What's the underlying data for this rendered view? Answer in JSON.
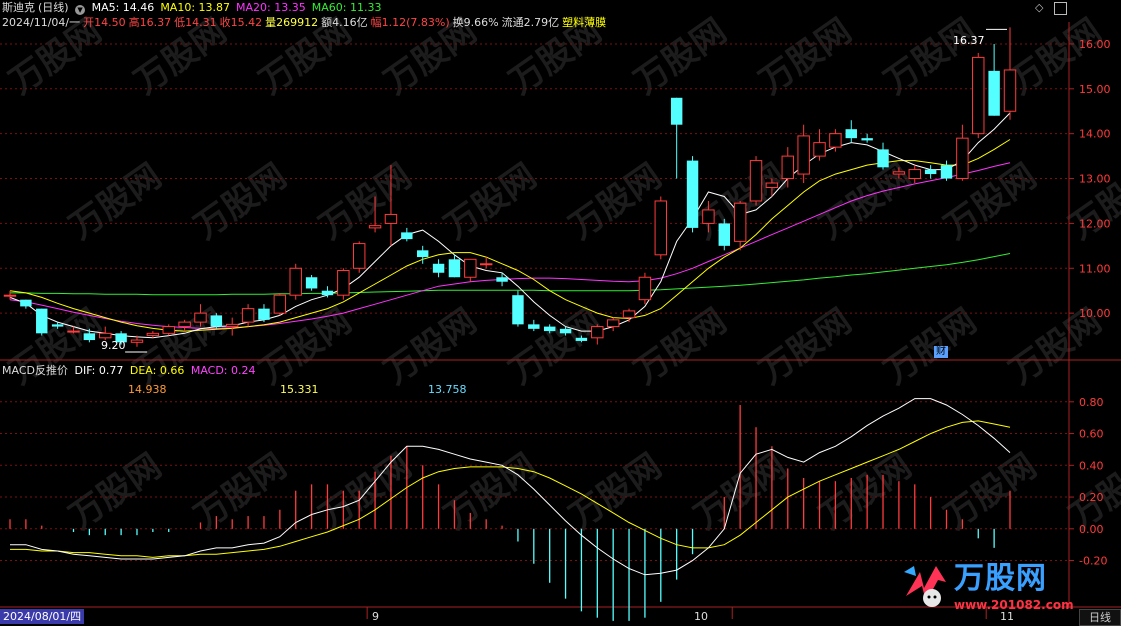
{
  "header": {
    "stock_name": "斯迪克",
    "period_label": "(日线)",
    "ma_items": [
      {
        "label": "MA5: 14.46",
        "color": "#ffffff"
      },
      {
        "label": "MA10: 13.87",
        "color": "#ffff00"
      },
      {
        "label": "MA20: 13.35",
        "color": "#ff33ff"
      },
      {
        "label": "MA60: 11.33",
        "color": "#33ee33"
      }
    ],
    "ohlc": [
      {
        "text": "2024/11/04/一",
        "color": "#dddddd"
      },
      {
        "text": "开14.50",
        "color": "#ff4444"
      },
      {
        "text": "高16.37",
        "color": "#ff4444"
      },
      {
        "text": "低14.31",
        "color": "#ff4444"
      },
      {
        "text": "收15.42",
        "color": "#ff4444"
      },
      {
        "text": "量269912",
        "color": "#ffff44"
      },
      {
        "text": "额4.16亿",
        "color": "#dddddd"
      },
      {
        "text": "幅1.12(7.83%)",
        "color": "#ff4444"
      },
      {
        "text": "换9.66%",
        "color": "#dddddd"
      },
      {
        "text": "流通2.79亿",
        "color": "#dddddd"
      },
      {
        "text": "塑料薄膜",
        "color": "#ffff00"
      }
    ]
  },
  "annotations": {
    "high_label": "16.37",
    "low_label": "9.20",
    "cai_badge": "财"
  },
  "macd_header": {
    "title": "MACD反推价",
    "dif": "DIF: 0.77",
    "dea": "DEA: 0.66",
    "macd": "MACD: 0.24",
    "values": [
      {
        "text": "14.938",
        "color": "#ff9933"
      },
      {
        "text": "15.331",
        "color": "#ffff55"
      },
      {
        "text": "13.758",
        "color": "#66ddff"
      }
    ]
  },
  "footer": {
    "date_label": "2024/08/01/四",
    "month_labels": [
      "9",
      "10",
      "11"
    ],
    "period_button": "日线"
  },
  "watermark": {
    "brand": "万股网",
    "url": "www.201082.com"
  },
  "colors": {
    "up": "#ff3b3b",
    "down": "#54ffff",
    "ma5": "#ffffff",
    "ma10": "#ffff00",
    "ma20": "#ff33ff",
    "ma60": "#33ee33",
    "grid": "#7a1010",
    "axis": "#aa2222"
  },
  "chart_data": [
    {
      "type": "candlestick",
      "ylim": [
        9.0,
        16.4
      ],
      "yticks": [
        "16.00",
        "15.00",
        "14.00",
        "13.00",
        "12.00",
        "11.00",
        "10.00"
      ],
      "ytick_values": [
        16,
        15,
        14,
        13,
        12,
        11,
        10
      ],
      "candles": [
        [
          10.4,
          10.5,
          10.3,
          10.4
        ],
        [
          10.3,
          10.3,
          10.1,
          10.15
        ],
        [
          10.1,
          10.1,
          9.5,
          9.55
        ],
        [
          9.75,
          9.8,
          9.65,
          9.7
        ],
        [
          9.6,
          9.7,
          9.55,
          9.6
        ],
        [
          9.55,
          9.65,
          9.35,
          9.4
        ],
        [
          9.45,
          9.7,
          9.4,
          9.55
        ],
        [
          9.55,
          9.6,
          9.3,
          9.35
        ],
        [
          9.35,
          9.5,
          9.25,
          9.4
        ],
        [
          9.5,
          9.6,
          9.45,
          9.55
        ],
        [
          9.55,
          9.75,
          9.5,
          9.7
        ],
        [
          9.7,
          9.85,
          9.6,
          9.8
        ],
        [
          9.8,
          10.2,
          9.7,
          10.0
        ],
        [
          9.95,
          10.0,
          9.65,
          9.7
        ],
        [
          9.7,
          9.9,
          9.5,
          9.75
        ],
        [
          9.8,
          10.2,
          9.7,
          10.1
        ],
        [
          10.1,
          10.2,
          9.8,
          9.85
        ],
        [
          10.0,
          10.45,
          9.95,
          10.4
        ],
        [
          10.4,
          11.1,
          10.3,
          11.0
        ],
        [
          10.8,
          10.85,
          10.5,
          10.55
        ],
        [
          10.5,
          10.6,
          10.35,
          10.4
        ],
        [
          10.4,
          11.0,
          10.3,
          10.95
        ],
        [
          11.0,
          11.6,
          10.9,
          11.55
        ],
        [
          11.9,
          12.6,
          11.8,
          11.95
        ],
        [
          12.0,
          13.3,
          11.5,
          12.2
        ],
        [
          11.8,
          11.9,
          11.6,
          11.65
        ],
        [
          11.4,
          11.5,
          11.1,
          11.25
        ],
        [
          11.1,
          11.2,
          10.8,
          10.9
        ],
        [
          11.2,
          11.3,
          10.8,
          10.8
        ],
        [
          10.8,
          11.2,
          10.7,
          11.2
        ],
        [
          11.1,
          11.25,
          11.0,
          11.1
        ],
        [
          10.8,
          10.9,
          10.6,
          10.7
        ],
        [
          10.4,
          10.5,
          9.7,
          9.75
        ],
        [
          9.75,
          9.85,
          9.6,
          9.65
        ],
        [
          9.7,
          9.75,
          9.55,
          9.6
        ],
        [
          9.65,
          9.7,
          9.5,
          9.55
        ],
        [
          9.45,
          9.5,
          9.35,
          9.38
        ],
        [
          9.45,
          9.75,
          9.3,
          9.7
        ],
        [
          9.7,
          9.9,
          9.6,
          9.85
        ],
        [
          9.9,
          10.1,
          9.8,
          10.05
        ],
        [
          10.3,
          10.9,
          10.2,
          10.8
        ],
        [
          11.3,
          12.6,
          11.2,
          12.5
        ],
        [
          14.8,
          14.8,
          13.0,
          14.2
        ],
        [
          13.4,
          13.5,
          11.8,
          11.9
        ],
        [
          12.0,
          12.5,
          11.8,
          12.3
        ],
        [
          12.0,
          12.1,
          11.4,
          11.5
        ],
        [
          11.6,
          12.5,
          11.4,
          12.45
        ],
        [
          12.5,
          13.5,
          12.4,
          13.4
        ],
        [
          12.8,
          13.0,
          12.6,
          12.9
        ],
        [
          13.0,
          13.7,
          12.8,
          13.5
        ],
        [
          13.1,
          14.2,
          12.9,
          13.95
        ],
        [
          13.5,
          14.1,
          13.4,
          13.8
        ],
        [
          13.7,
          14.1,
          13.6,
          14.0
        ],
        [
          14.1,
          14.3,
          13.8,
          13.9
        ],
        [
          13.9,
          14.0,
          13.8,
          13.85
        ],
        [
          13.65,
          13.8,
          13.2,
          13.25
        ],
        [
          13.1,
          13.25,
          13.0,
          13.15
        ],
        [
          13.0,
          13.3,
          12.9,
          13.2
        ],
        [
          13.2,
          13.3,
          13.0,
          13.1
        ],
        [
          13.3,
          13.4,
          12.95,
          13.0
        ],
        [
          13.0,
          14.2,
          12.95,
          13.9
        ],
        [
          14.0,
          15.8,
          13.9,
          15.7
        ],
        [
          15.4,
          16.0,
          14.4,
          14.4
        ],
        [
          14.5,
          16.37,
          14.31,
          15.42
        ]
      ],
      "ma5": [
        10.35,
        10.22,
        9.95,
        9.8,
        9.7,
        9.6,
        9.55,
        9.5,
        9.47,
        9.45,
        9.5,
        9.55,
        9.65,
        9.7,
        9.72,
        9.8,
        9.85,
        9.95,
        10.15,
        10.3,
        10.4,
        10.55,
        10.8,
        11.15,
        11.5,
        11.75,
        11.85,
        11.6,
        11.3,
        11.05,
        10.95,
        10.9,
        10.6,
        10.25,
        9.95,
        9.7,
        9.6,
        9.6,
        9.7,
        9.85,
        10.15,
        10.7,
        11.6,
        12.1,
        12.7,
        12.6,
        12.2,
        12.3,
        12.6,
        13.0,
        13.3,
        13.55,
        13.7,
        13.8,
        13.75,
        13.6,
        13.45,
        13.3,
        13.2,
        13.2,
        13.4,
        13.8,
        14.1,
        14.46
      ],
      "ma10": [
        10.5,
        10.45,
        10.35,
        10.22,
        10.1,
        10.0,
        9.9,
        9.8,
        9.72,
        9.66,
        9.62,
        9.6,
        9.62,
        9.64,
        9.66,
        9.7,
        9.74,
        9.8,
        9.9,
        10.0,
        10.1,
        10.25,
        10.45,
        10.65,
        10.85,
        11.05,
        11.2,
        11.3,
        11.35,
        11.35,
        11.25,
        11.1,
        10.95,
        10.75,
        10.5,
        10.3,
        10.15,
        10.0,
        9.9,
        9.88,
        9.95,
        10.1,
        10.4,
        10.7,
        11.0,
        11.25,
        11.45,
        11.75,
        12.1,
        12.4,
        12.7,
        12.95,
        13.1,
        13.2,
        13.3,
        13.35,
        13.4,
        13.4,
        13.35,
        13.3,
        13.3,
        13.45,
        13.65,
        13.87
      ],
      "ma20": [
        10.3,
        10.25,
        10.18,
        10.1,
        10.02,
        9.95,
        9.88,
        9.82,
        9.77,
        9.73,
        9.7,
        9.68,
        9.66,
        9.66,
        9.67,
        9.7,
        9.73,
        9.77,
        9.82,
        9.87,
        9.93,
        10.0,
        10.1,
        10.2,
        10.3,
        10.4,
        10.5,
        10.6,
        10.65,
        10.7,
        10.73,
        10.75,
        10.77,
        10.78,
        10.78,
        10.77,
        10.75,
        10.73,
        10.71,
        10.7,
        10.72,
        10.78,
        10.88,
        11.0,
        11.15,
        11.3,
        11.45,
        11.6,
        11.75,
        11.9,
        12.05,
        12.2,
        12.35,
        12.5,
        12.62,
        12.72,
        12.8,
        12.88,
        12.95,
        13.02,
        13.1,
        13.18,
        13.27,
        13.35
      ],
      "ma60": [
        10.45,
        10.45,
        10.44,
        10.44,
        10.43,
        10.43,
        10.42,
        10.42,
        10.42,
        10.41,
        10.41,
        10.41,
        10.41,
        10.41,
        10.42,
        10.42,
        10.42,
        10.43,
        10.43,
        10.44,
        10.44,
        10.45,
        10.46,
        10.47,
        10.48,
        10.49,
        10.5,
        10.51,
        10.51,
        10.51,
        10.51,
        10.51,
        10.51,
        10.51,
        10.5,
        10.5,
        10.5,
        10.5,
        10.5,
        10.5,
        10.51,
        10.52,
        10.54,
        10.56,
        10.58,
        10.6,
        10.62,
        10.65,
        10.68,
        10.71,
        10.74,
        10.78,
        10.81,
        10.85,
        10.88,
        10.92,
        10.96,
        11.0,
        11.04,
        11.08,
        11.13,
        11.19,
        11.26,
        11.33
      ]
    },
    {
      "type": "macd",
      "ylim": [
        -0.48,
        0.95
      ],
      "yticks": [
        "0.80",
        "0.60",
        "0.40",
        "0.20",
        "0.00",
        "-0.20"
      ],
      "ytick_values": [
        0.8,
        0.6,
        0.4,
        0.2,
        0.0,
        -0.2
      ],
      "dif": [
        -0.1,
        -0.1,
        -0.13,
        -0.14,
        -0.16,
        -0.17,
        -0.18,
        -0.19,
        -0.19,
        -0.19,
        -0.18,
        -0.17,
        -0.14,
        -0.12,
        -0.12,
        -0.1,
        -0.09,
        -0.05,
        0.04,
        0.09,
        0.12,
        0.14,
        0.18,
        0.3,
        0.42,
        0.52,
        0.52,
        0.5,
        0.47,
        0.44,
        0.42,
        0.4,
        0.34,
        0.25,
        0.15,
        0.05,
        -0.04,
        -0.12,
        -0.19,
        -0.25,
        -0.29,
        -0.28,
        -0.26,
        -0.2,
        -0.12,
        0.0,
        0.35,
        0.47,
        0.5,
        0.45,
        0.42,
        0.48,
        0.52,
        0.58,
        0.65,
        0.71,
        0.76,
        0.82,
        0.82,
        0.78,
        0.72,
        0.65,
        0.57,
        0.48
      ],
      "dea": [
        -0.13,
        -0.13,
        -0.14,
        -0.14,
        -0.15,
        -0.15,
        -0.16,
        -0.17,
        -0.17,
        -0.18,
        -0.17,
        -0.17,
        -0.16,
        -0.16,
        -0.15,
        -0.14,
        -0.13,
        -0.11,
        -0.08,
        -0.05,
        -0.02,
        0.02,
        0.06,
        0.12,
        0.19,
        0.26,
        0.32,
        0.36,
        0.38,
        0.39,
        0.39,
        0.39,
        0.38,
        0.36,
        0.32,
        0.27,
        0.22,
        0.16,
        0.1,
        0.04,
        -0.01,
        -0.06,
        -0.1,
        -0.12,
        -0.12,
        -0.1,
        -0.04,
        0.04,
        0.12,
        0.2,
        0.25,
        0.3,
        0.34,
        0.38,
        0.42,
        0.46,
        0.5,
        0.55,
        0.6,
        0.64,
        0.67,
        0.68,
        0.66,
        0.64
      ],
      "macd": [
        0.06,
        0.06,
        0.02,
        0.0,
        -0.02,
        -0.04,
        -0.04,
        -0.04,
        -0.04,
        -0.02,
        -0.02,
        0.0,
        0.04,
        0.08,
        0.06,
        0.08,
        0.08,
        0.12,
        0.24,
        0.28,
        0.28,
        0.24,
        0.24,
        0.36,
        0.46,
        0.52,
        0.4,
        0.28,
        0.18,
        0.1,
        0.06,
        0.02,
        -0.08,
        -0.22,
        -0.34,
        -0.44,
        -0.52,
        -0.56,
        -0.58,
        -0.58,
        -0.56,
        -0.46,
        -0.32,
        -0.16,
        0.0,
        0.2,
        0.78,
        0.64,
        0.52,
        0.38,
        0.32,
        0.3,
        0.3,
        0.32,
        0.34,
        0.34,
        0.3,
        0.28,
        0.2,
        0.12,
        0.06,
        -0.06,
        -0.12,
        0.24
      ]
    }
  ]
}
